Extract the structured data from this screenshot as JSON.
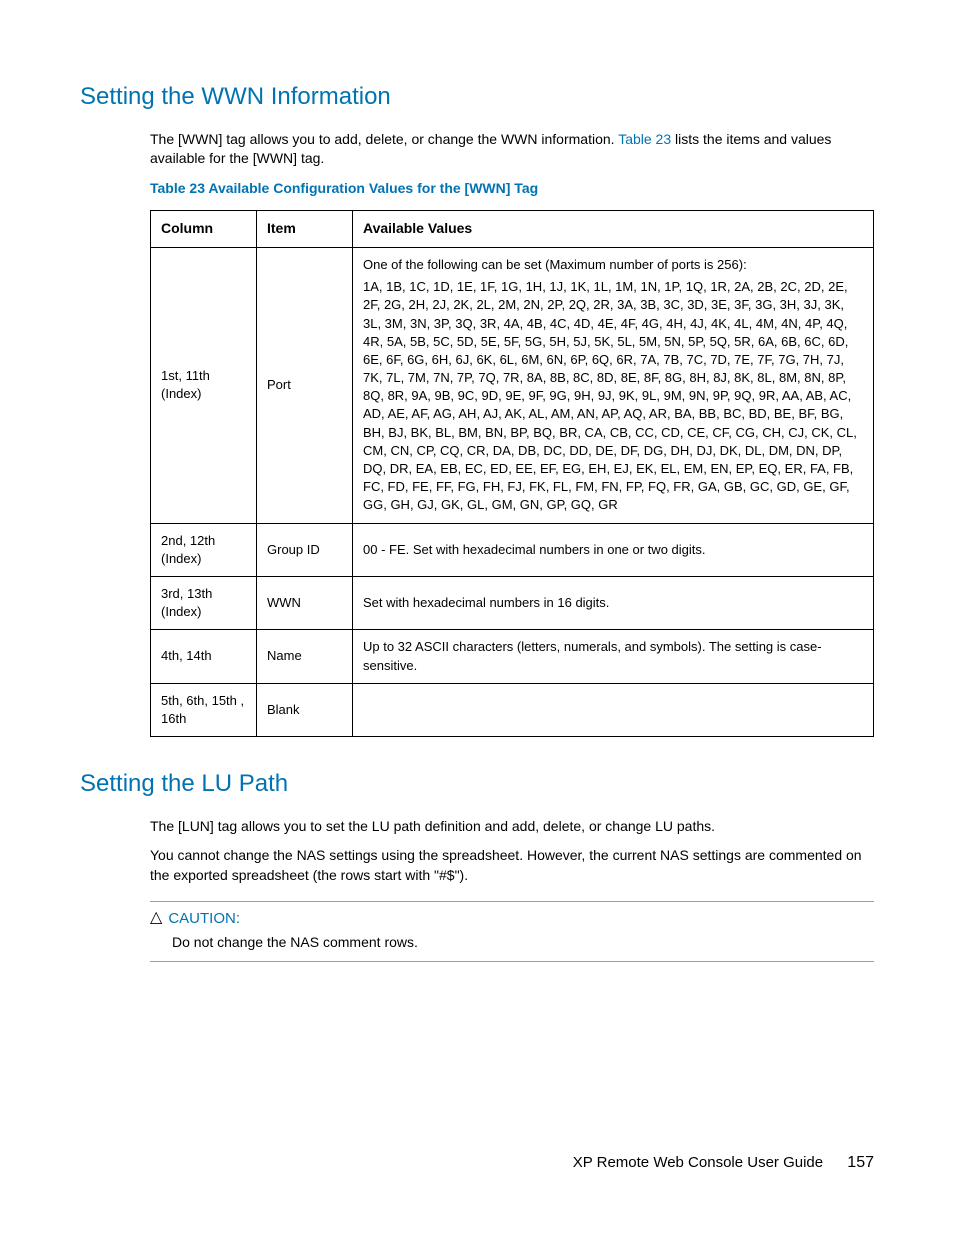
{
  "section1": {
    "heading": "Setting the WWN Information",
    "intro_before_link": "The [WWN] tag allows you to add, delete, or change the WWN information. ",
    "intro_link": "Table 23",
    "intro_after_link": " lists the items and values available for the [WWN] tag.",
    "table_caption": "Table 23 Available Configuration Values for the [WWN] Tag",
    "headers": {
      "c1": "Column",
      "c2": "Item",
      "c3": "Available Values"
    },
    "rows": [
      {
        "col": "1st, 11th (Index)",
        "item": "Port",
        "values_intro": "One of the following can be set (Maximum number of ports is 256):",
        "values": "1A, 1B, 1C, 1D, 1E, 1F, 1G, 1H, 1J, 1K, 1L, 1M, 1N, 1P, 1Q, 1R, 2A, 2B, 2C, 2D, 2E, 2F, 2G, 2H, 2J, 2K, 2L, 2M, 2N, 2P, 2Q, 2R, 3A, 3B, 3C, 3D, 3E, 3F, 3G, 3H, 3J, 3K, 3L, 3M, 3N, 3P, 3Q, 3R, 4A, 4B, 4C, 4D, 4E, 4F, 4G, 4H, 4J, 4K, 4L, 4M, 4N, 4P, 4Q, 4R, 5A, 5B, 5C, 5D, 5E, 5F, 5G, 5H, 5J, 5K, 5L, 5M, 5N, 5P, 5Q, 5R, 6A, 6B, 6C, 6D, 6E, 6F, 6G, 6H, 6J, 6K, 6L, 6M, 6N, 6P, 6Q, 6R, 7A, 7B, 7C, 7D, 7E, 7F, 7G, 7H, 7J, 7K, 7L, 7M, 7N, 7P, 7Q, 7R, 8A, 8B, 8C, 8D, 8E, 8F, 8G, 8H, 8J, 8K, 8L, 8M, 8N, 8P, 8Q, 8R, 9A, 9B, 9C, 9D, 9E, 9F, 9G, 9H, 9J, 9K, 9L, 9M, 9N, 9P, 9Q, 9R, AA, AB, AC, AD, AE, AF, AG, AH, AJ, AK, AL, AM, AN, AP, AQ, AR, BA, BB, BC, BD, BE, BF, BG, BH, BJ, BK, BL, BM, BN, BP, BQ, BR, CA, CB, CC, CD, CE, CF, CG, CH, CJ, CK, CL, CM, CN, CP, CQ, CR, DA, DB, DC, DD, DE, DF, DG, DH, DJ, DK, DL, DM, DN, DP, DQ, DR, EA, EB, EC, ED, EE, EF, EG, EH, EJ, EK, EL, EM, EN, EP, EQ, ER, FA, FB, FC, FD, FE, FF, FG, FH, FJ, FK, FL, FM, FN, FP, FQ, FR, GA, GB, GC, GD, GE, GF, GG, GH, GJ, GK, GL, GM, GN, GP, GQ, GR"
      },
      {
        "col": "2nd, 12th (Index)",
        "item": "Group ID",
        "values": "00 - FE. Set with hexadecimal numbers in one or two digits."
      },
      {
        "col": "3rd, 13th (Index)",
        "item": "WWN",
        "values": "Set with hexadecimal numbers in 16 digits."
      },
      {
        "col": "4th, 14th",
        "item": "Name",
        "values": "Up to 32 ASCII characters (letters, numerals, and symbols). The setting is case-sensitive."
      },
      {
        "col": "5th, 6th, 15th , 16th",
        "item": "Blank",
        "values": ""
      }
    ]
  },
  "section2": {
    "heading": "Setting the LU Path",
    "para1": "The [LUN] tag allows you to set the LU path definition and add, delete, or change LU paths.",
    "para2": "You cannot change the NAS settings using the spreadsheet. However, the current NAS settings are commented on the exported spreadsheet (the rows start with \"#$\").",
    "caution_label": "CAUTION:",
    "caution_text": "Do not change the NAS comment rows."
  },
  "footer": {
    "title": "XP Remote Web Console User Guide",
    "page": "157"
  }
}
